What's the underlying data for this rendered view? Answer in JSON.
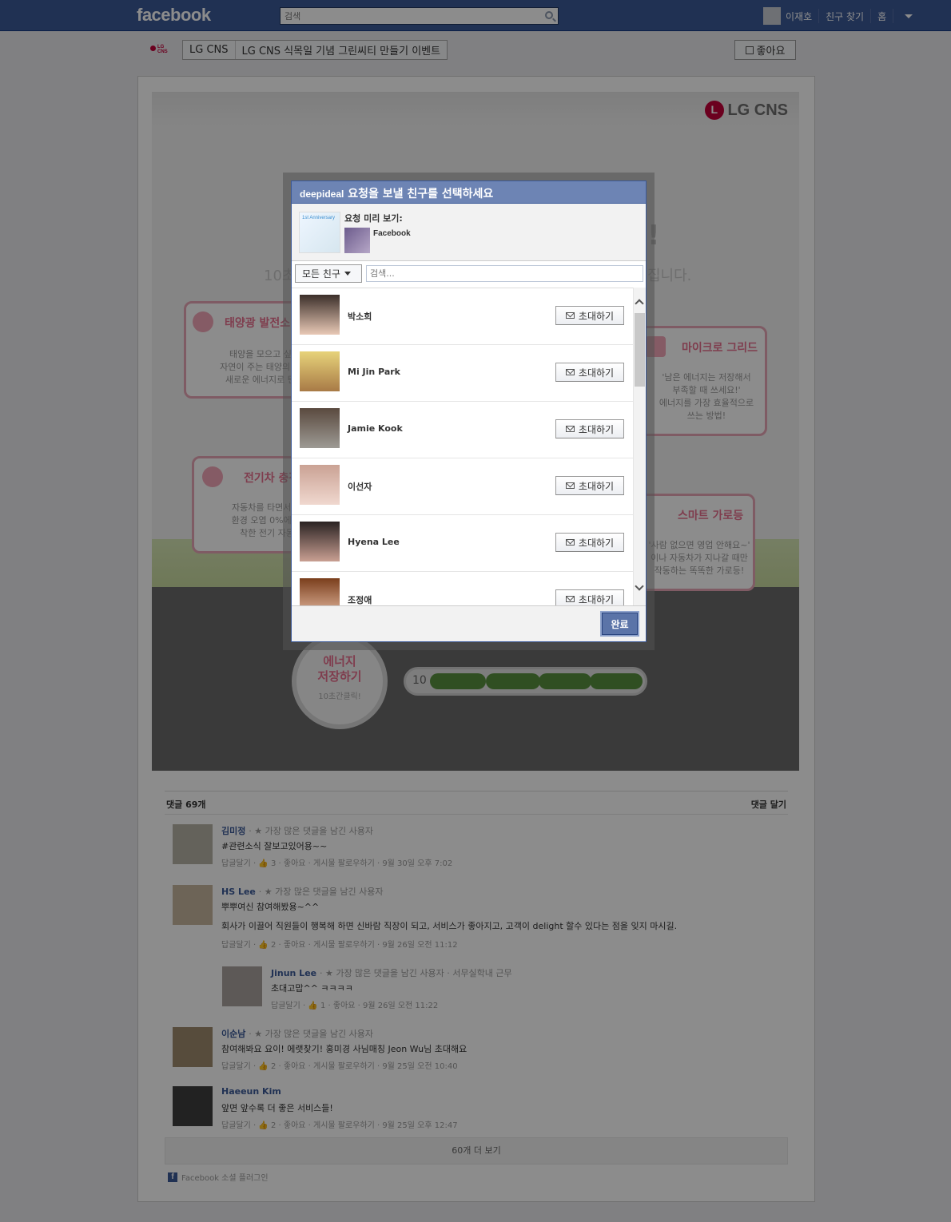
{
  "topbar": {
    "logo": "facebook",
    "search_placeholder": "검색",
    "user_name": "이재호",
    "find_friends": "친구 찾기",
    "home": "홈"
  },
  "page_header": {
    "crumb_page": "LG CNS",
    "crumb_title": "LG CNS 식목일 기념 그린씨티 만들기 이벤트",
    "like_label": "좋아요",
    "mini_logo": "LG CNS"
  },
  "banner": {
    "logo_text": "LG CNS",
    "headline_frag": "!",
    "sub_left": "10초",
    "sub_right": "집니다.",
    "cards": [
      {
        "title": "태양광 발전소",
        "body": [
          "태양을 모으고 싶어",
          "자연이 주는 태양의 기운",
          "새로운 에너지로 탄생"
        ]
      },
      {
        "title": "마이크로 그리드",
        "body": [
          "'남은 에너지는 저장해서",
          "부족할 때 쓰세요!'",
          "에너지를 가장 효율적으로",
          "쓰는 방법!"
        ]
      },
      {
        "title": "전기차 충전",
        "body": [
          "자동차를 타면서 발",
          "환경 오염 0%에 도",
          "착한 전기 자동"
        ]
      },
      {
        "title": "스마트 가로등",
        "body": [
          "'사람 없으면 영업 안해요~'",
          "이나 자동차가 지나갈 때만",
          "작동하는 똑똑한 가로등!"
        ]
      }
    ],
    "energy_btn": {
      "line1": "에너지",
      "line2": "저장하기",
      "line3": "10초간클릭!"
    },
    "gauge_value": "10"
  },
  "comments": {
    "count_label": "댓글 69개",
    "write_label": "댓글 달기",
    "items": [
      {
        "name": "김미정",
        "badge": "· ★ 가장 많은 댓글을 남긴 사용자",
        "text": "#관련소식 잘보고있어용~~",
        "text2": "",
        "meta": "답글달기 · 👍 3 · 좋아요 · 게시물 팔로우하기 · 9월 30일 오후 7:02"
      },
      {
        "name": "HS Lee",
        "badge": "· ★ 가장 많은 댓글을 남긴 사용자",
        "text": "뿌뿌여신 참여해봤용~^^",
        "text2": "회사가 이끌어 직원들이 행복해 하면 신바람 직장이 되고, 서비스가 좋아지고, 고객이 delight 할수 있다는 점을 잊지 마시길.",
        "meta": "답글달기 · 👍 2 · 좋아요 · 게시물 팔로우하기 · 9월 26일 오전 11:12"
      },
      {
        "name": "Jinun Lee",
        "badge": "· ★ 가장 많은 댓글을 남긴 사용자 · 서무실학내 근무",
        "text": "초대고맙^^ ㅋㅋㅋㅋ",
        "text2": "",
        "meta": "답글달기 · 👍 1 · 좋아요 · 9월 26일 오전 11:22"
      },
      {
        "name": "이순남",
        "badge": "· ★ 가장 많은 댓글을 남긴 사용자",
        "text": "참여해봐요 요이! 에랫찾기! 홍미경 사님매칭 Jeon Wu님 초대해요",
        "text2": "",
        "meta": "답글달기 · 👍 2 · 좋아요 · 게시물 팔로우하기 · 9월 25일 오전 10:40"
      },
      {
        "name": "Haeeun Kim",
        "badge": "",
        "text": "앞면 앞수록 더 좋은 서비스들!",
        "text2": "",
        "meta": "답글달기 · 👍 2 · 좋아요 · 게시물 팔로우하기 · 9월 25일 오후 12:47"
      }
    ],
    "more_label": "60개 더 보기",
    "social_plugin": "Facebook 소셜 플러그인"
  },
  "dialog": {
    "title_app": "deepideal",
    "title_text": " 요청을 보낼 친구를 선택하세요",
    "preview_label": "요청 미리 보기:",
    "preview_img_text": "1st Anniversary",
    "preview_name": "Facebook",
    "filter_label": "모든 친구",
    "search_placeholder": "검색...",
    "invite_label": "초대하기",
    "done_label": "완료",
    "friends": [
      {
        "name": "박소희"
      },
      {
        "name": "Mi Jin Park"
      },
      {
        "name": "Jamie Kook"
      },
      {
        "name": "이선자"
      },
      {
        "name": "Hyena Lee"
      },
      {
        "name": "조정애"
      }
    ]
  }
}
